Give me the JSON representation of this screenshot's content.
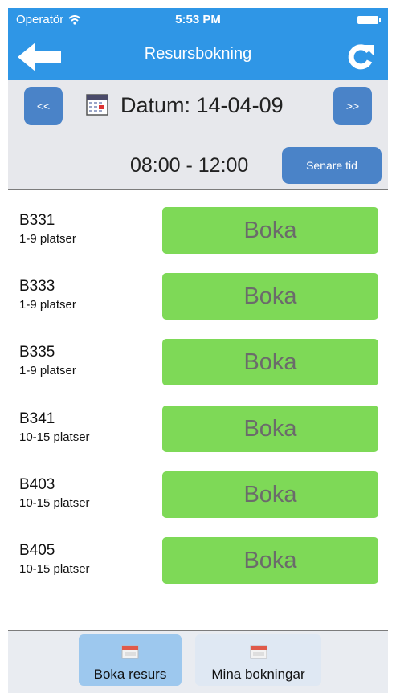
{
  "status_bar": {
    "carrier": "Operatör",
    "time": "5:53 PM"
  },
  "nav": {
    "title": "Resursbokning",
    "back_icon": "back-arrow-icon",
    "refresh_icon": "refresh-icon"
  },
  "controls": {
    "prev_label": "<<",
    "next_label": ">>",
    "date_text": "Datum: 14-04-09",
    "time_range": "08:00 - 12:00",
    "later_label": "Senare tid"
  },
  "resources": [
    {
      "code": "B331",
      "capacity": "1-9 platser",
      "action": "Boka"
    },
    {
      "code": "B333",
      "capacity": "1-9 platser",
      "action": "Boka"
    },
    {
      "code": "B335",
      "capacity": "1-9 platser",
      "action": "Boka"
    },
    {
      "code": "B341",
      "capacity": "10-15 platser",
      "action": "Boka"
    },
    {
      "code": "B403",
      "capacity": "10-15 platser",
      "action": "Boka"
    },
    {
      "code": "B405",
      "capacity": "10-15 platser",
      "action": "Boka"
    }
  ],
  "tabs": [
    {
      "label": "Boka resurs",
      "selected": true,
      "icon": "calendar-icon"
    },
    {
      "label": "Mina bokningar",
      "selected": false,
      "icon": "calendar-icon"
    }
  ],
  "colors": {
    "header": "#2f96e6",
    "nav_button": "#4a83c8",
    "book_button": "#7ed957",
    "controls_bg": "#e7e8ec",
    "tabbar_bg": "#e9ecf1"
  }
}
